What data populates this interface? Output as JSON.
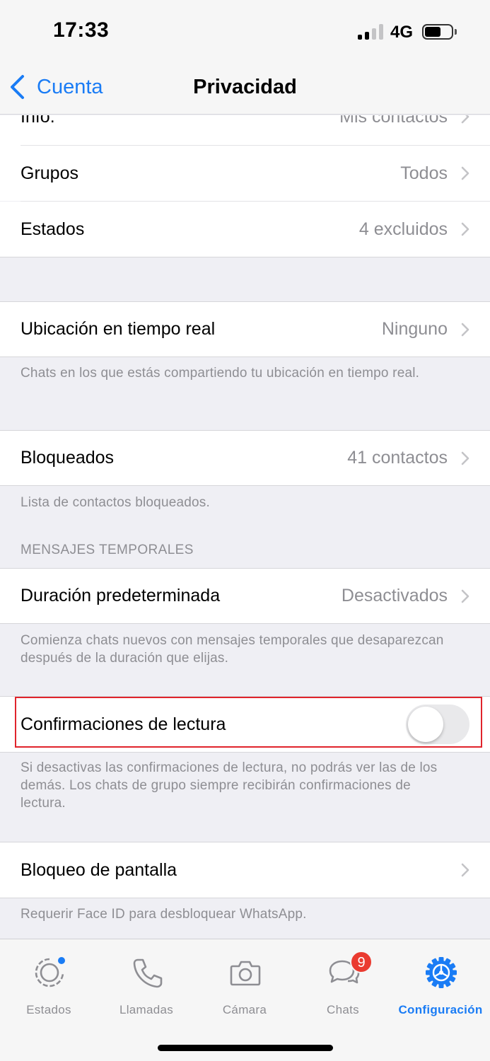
{
  "status_bar": {
    "time": "17:33",
    "network": "4G"
  },
  "nav": {
    "back_label": "Cuenta",
    "title": "Privacidad"
  },
  "rows": {
    "info": {
      "label": "Info.",
      "value": "Mis contactos"
    },
    "grupos": {
      "label": "Grupos",
      "value": "Todos"
    },
    "estados": {
      "label": "Estados",
      "value": "4 excluidos"
    },
    "ubicacion": {
      "label": "Ubicación en tiempo real",
      "value": "Ninguno"
    },
    "bloqueados": {
      "label": "Bloqueados",
      "value": "41 contactos"
    },
    "duracion": {
      "label": "Duración predeterminada",
      "value": "Desactivados"
    },
    "confirmaciones": {
      "label": "Confirmaciones de lectura",
      "enabled": false
    },
    "bloqueo_pantalla": {
      "label": "Bloqueo de pantalla"
    }
  },
  "footnotes": {
    "ubicacion": "Chats en los que estás compartiendo tu ubicación en tiempo real.",
    "bloqueados": "Lista de contactos bloqueados.",
    "duracion": "Comienza chats nuevos con mensajes temporales que desaparezcan después de la duración que elijas.",
    "confirmaciones": "Si desactivas las confirmaciones de lectura, no podrás ver las de los demás. Los chats de grupo siempre recibirán confirmaciones de lectura.",
    "bloqueo_pantalla": "Requerir Face ID para desbloquear WhatsApp."
  },
  "section_headers": {
    "mensajes_temporales": "MENSAJES TEMPORALES"
  },
  "tabs": [
    {
      "label": "Estados",
      "icon": "status-icon"
    },
    {
      "label": "Llamadas",
      "icon": "phone-icon"
    },
    {
      "label": "Cámara",
      "icon": "camera-icon"
    },
    {
      "label": "Chats",
      "icon": "chats-icon",
      "badge": "9"
    },
    {
      "label": "Configuración",
      "icon": "gear-icon",
      "active": true
    }
  ],
  "colors": {
    "accent": "#1a7cf5",
    "badge": "#ea3b30",
    "highlight": "#e0242c",
    "secondary_text": "#8e8e93",
    "background": "#efeff4"
  }
}
